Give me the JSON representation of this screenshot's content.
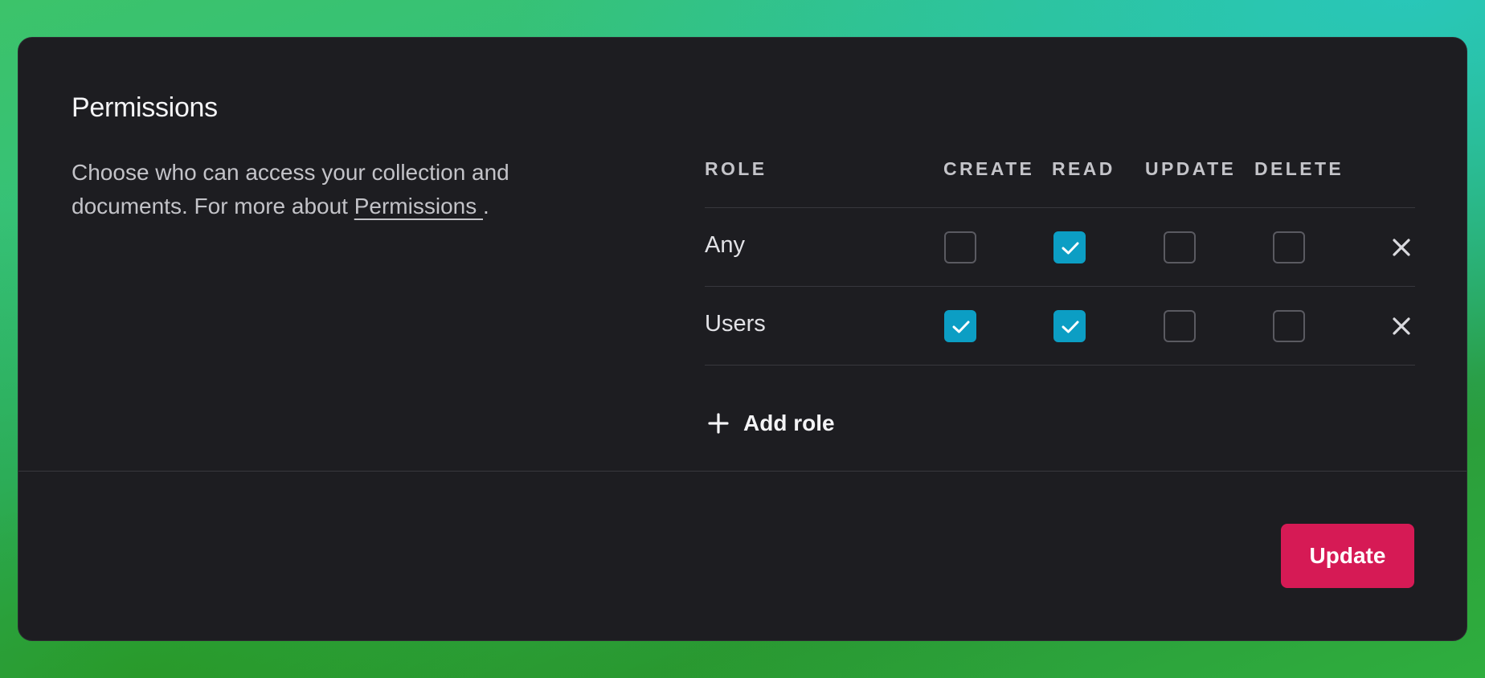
{
  "section": {
    "title": "Permissions",
    "description": "Choose who can access your collection and documents. For more about ",
    "link_text": "Permissions ",
    "description_end": "."
  },
  "table": {
    "headers": {
      "role": "ROLE",
      "create": "CREATE",
      "read": "READ",
      "update": "UPDATE",
      "delete": "DELETE"
    },
    "rows": [
      {
        "role": "Any",
        "create": false,
        "read": true,
        "update": false,
        "delete": false
      },
      {
        "role": "Users",
        "create": true,
        "read": true,
        "update": false,
        "delete": false
      }
    ]
  },
  "add_role_label": "Add role",
  "update_button_label": "Update",
  "colors": {
    "checkbox_checked": "#0c9ec4",
    "primary_button": "#d61a55",
    "card_background": "#1d1d21"
  },
  "icons": {
    "check": "check-icon",
    "remove": "close-icon",
    "add": "plus-icon"
  }
}
